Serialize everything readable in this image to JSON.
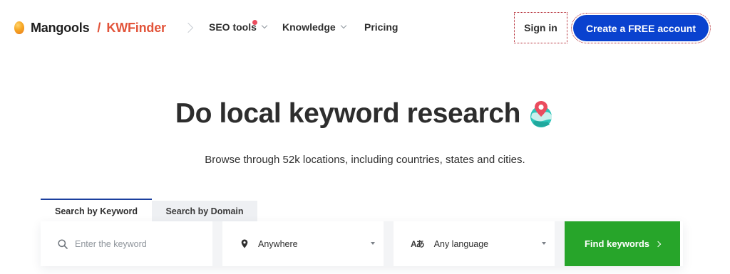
{
  "header": {
    "brand": "Mangools",
    "separator": "/",
    "product": "KWFinder",
    "nav": {
      "seo_tools": "SEO tools",
      "knowledge": "Knowledge",
      "pricing": "Pricing"
    },
    "signin_label": "Sign in",
    "create_label": "Create a FREE account"
  },
  "hero": {
    "title": "Do local keyword research",
    "subtitle": "Browse through 52k locations, including countries, states and cities."
  },
  "tabs": {
    "keyword": "Search by Keyword",
    "domain": "Search by Domain"
  },
  "search": {
    "keyword_placeholder": "Enter the keyword",
    "location_value": "Anywhere",
    "language_value": "Any language",
    "language_icon_text": "Aあ",
    "find_label": "Find keywords"
  },
  "colors": {
    "brand_orange": "#e2543a",
    "primary_blue": "#0a42cf",
    "find_green": "#27a52a",
    "tab_active_border": "#1b3f9e",
    "notification_dot": "#ea4c5e"
  },
  "icons": {
    "logo": "mangools-logo-icon",
    "search": "search-icon",
    "location": "location-pin-icon",
    "language": "translate-icon",
    "globe": "globe-pin-icon"
  }
}
